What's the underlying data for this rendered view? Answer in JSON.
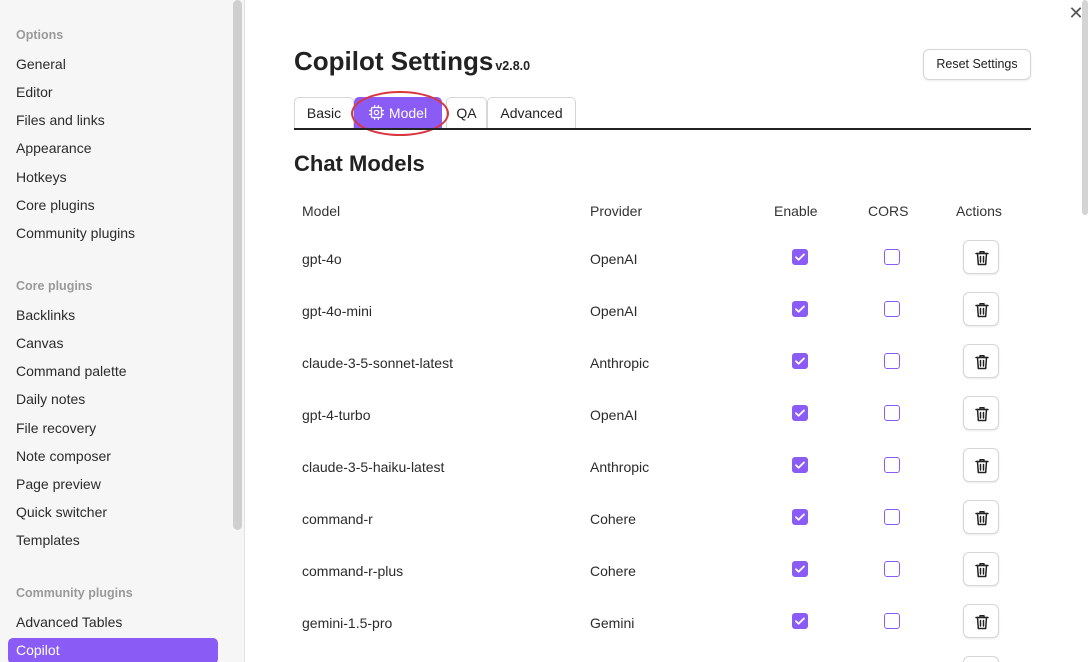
{
  "sidebar": {
    "options_title": "Options",
    "options": [
      "General",
      "Editor",
      "Files and links",
      "Appearance",
      "Hotkeys",
      "Core plugins",
      "Community plugins"
    ],
    "core_title": "Core plugins",
    "core": [
      "Backlinks",
      "Canvas",
      "Command palette",
      "Daily notes",
      "File recovery",
      "Note composer",
      "Page preview",
      "Quick switcher",
      "Templates"
    ],
    "community_title": "Community plugins",
    "community": [
      "Advanced Tables"
    ],
    "active": "Copilot"
  },
  "header": {
    "title": "Copilot Settings",
    "version": "v2.8.0",
    "reset_label": "Reset Settings"
  },
  "tabs": [
    {
      "label": "Basic",
      "active": false
    },
    {
      "label": "Model",
      "active": true,
      "icon": "gear-icon"
    },
    {
      "label": "QA",
      "active": false
    },
    {
      "label": "Advanced",
      "active": false
    }
  ],
  "section_title": "Chat Models",
  "table": {
    "headers": [
      "Model",
      "Provider",
      "Enable",
      "CORS",
      "Actions"
    ],
    "rows": [
      {
        "model": "gpt-4o",
        "provider": "OpenAI",
        "enable": true,
        "cors": false
      },
      {
        "model": "gpt-4o-mini",
        "provider": "OpenAI",
        "enable": true,
        "cors": false
      },
      {
        "model": "claude-3-5-sonnet-latest",
        "provider": "Anthropic",
        "enable": true,
        "cors": false
      },
      {
        "model": "gpt-4-turbo",
        "provider": "OpenAI",
        "enable": true,
        "cors": false
      },
      {
        "model": "claude-3-5-haiku-latest",
        "provider": "Anthropic",
        "enable": true,
        "cors": false
      },
      {
        "model": "command-r",
        "provider": "Cohere",
        "enable": true,
        "cors": false
      },
      {
        "model": "command-r-plus",
        "provider": "Cohere",
        "enable": true,
        "cors": false
      },
      {
        "model": "gemini-1.5-pro",
        "provider": "Gemini",
        "enable": true,
        "cors": false
      }
    ]
  },
  "colors": {
    "accent": "#8a5cf5",
    "highlight_ring": "#d9363e"
  }
}
